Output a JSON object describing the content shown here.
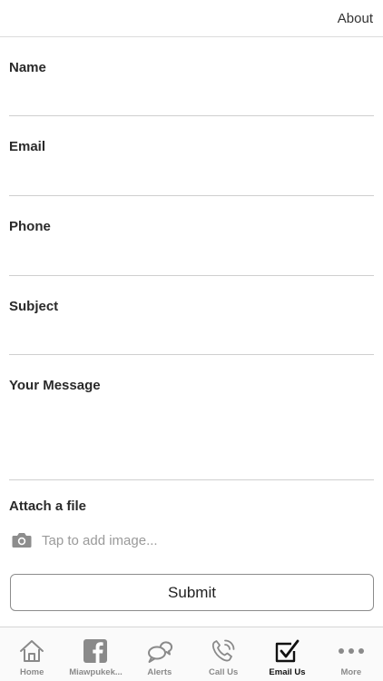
{
  "header": {
    "about_label": "About"
  },
  "form": {
    "name_label": "Name",
    "email_label": "Email",
    "phone_label": "Phone",
    "subject_label": "Subject",
    "message_label": "Your Message",
    "name_value": "",
    "email_value": "",
    "phone_value": "",
    "subject_value": "",
    "message_value": "",
    "attach_label": "Attach a file",
    "attach_placeholder": "Tap to add image...",
    "attach_icon": "camera-icon",
    "submit_label": "Submit"
  },
  "tabbar": {
    "active_tab": "Email Us",
    "tabs": [
      {
        "label": "Home",
        "icon": "home-icon"
      },
      {
        "label": "Miawpukek...",
        "icon": "facebook-icon"
      },
      {
        "label": "Alerts",
        "icon": "chat-bubbles-icon"
      },
      {
        "label": "Call Us",
        "icon": "phone-icon"
      },
      {
        "label": "Email Us",
        "icon": "checkbox-icon"
      },
      {
        "label": "More",
        "icon": "more-dots-icon"
      }
    ]
  },
  "colors": {
    "inactive_icon": "#8a8a8a",
    "active_icon": "#111111",
    "divider": "#cfcfcf"
  }
}
